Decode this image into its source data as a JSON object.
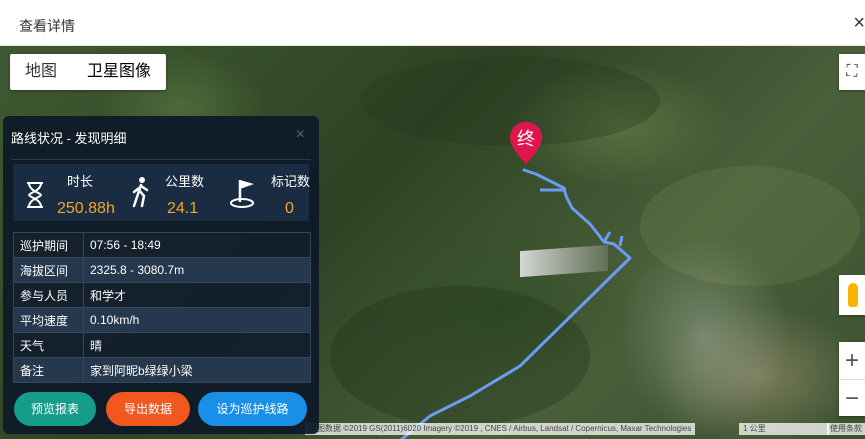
{
  "dialog": {
    "title": "查看详情",
    "close_label": "×"
  },
  "map": {
    "type_toggle": {
      "map_label": "地图",
      "satellite_label": "卫星图像"
    },
    "fullscreen_label": "⛶",
    "zoom_in_label": "+",
    "zoom_out_label": "−",
    "attribution": "地图数据 ©2019 GS(2011)6020 Imagery ©2019 , CNES / Airbus, Landsat / Copernicus, Maxar Technologies",
    "scale_label": "1 公里",
    "terms_label": "使用条款",
    "end_marker_label": "终",
    "route_color": "#6b9cf0"
  },
  "panel": {
    "title": "路线状况 - 发现明细",
    "close_label": "×",
    "stats": [
      {
        "label": "时长",
        "value": "250.88h",
        "icon": "hourglass-icon"
      },
      {
        "label": "公里数",
        "value": "24.1",
        "icon": "walking-person-icon"
      },
      {
        "label": "标记数",
        "value": "0",
        "icon": "flag-icon"
      }
    ],
    "details": [
      {
        "key": "巡护期间",
        "value": "07:56 - 18:49"
      },
      {
        "key": "海拔区间",
        "value": "2325.8 - 3080.7m"
      },
      {
        "key": "参与人员",
        "value": "和学才"
      },
      {
        "key": "平均速度",
        "value": "0.10km/h"
      },
      {
        "key": "天气",
        "value": "晴"
      },
      {
        "key": "备注",
        "value": "家到阿昵b绿绿小梁"
      }
    ],
    "buttons": {
      "preview": "预览报表",
      "export": "导出数据",
      "set_route": "设为巡护线路"
    }
  }
}
